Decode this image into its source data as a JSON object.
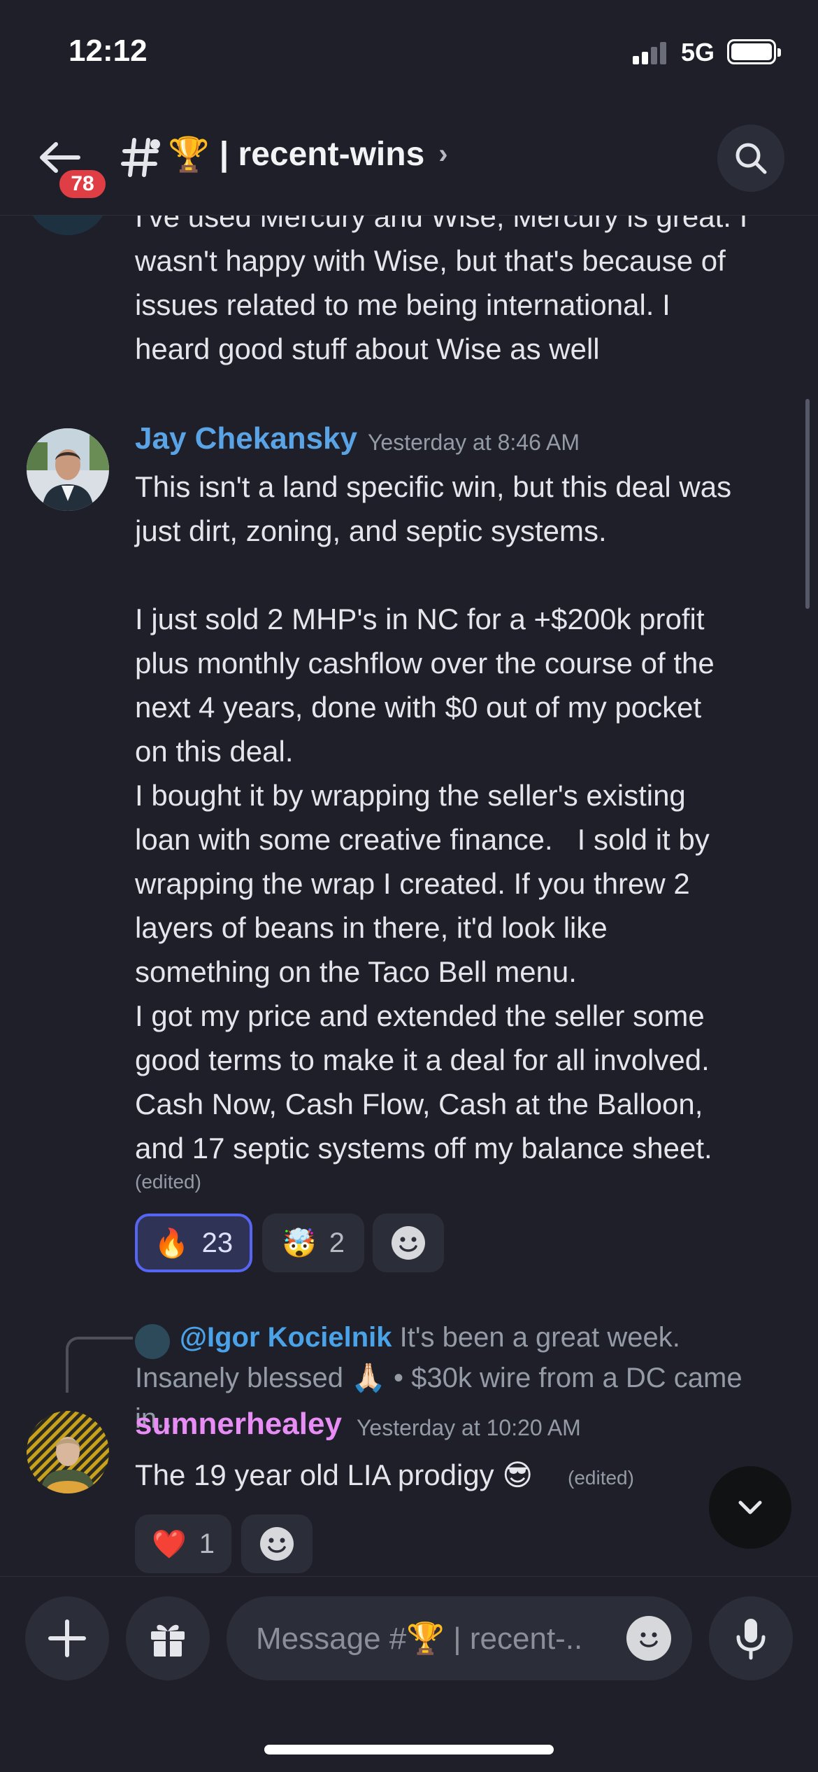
{
  "status_bar": {
    "time": "12:12",
    "network": "5G"
  },
  "header": {
    "mention_count": "78",
    "channel_emoji": "🏆",
    "channel_name": "| recent-wins",
    "chevron": "›"
  },
  "messages": [
    {
      "id": "prev",
      "text": "I've used Mercury and Wise, Mercury is great. I\nwasn't happy with Wise, but that's because of\nissues related to me being international. I\nheard good stuff about Wise as well"
    },
    {
      "id": "jay",
      "author": "Jay Chekansky",
      "author_color": "#5aa4e6",
      "timestamp": "Yesterday at 8:46 AM",
      "text": "This isn't a land specific win, but this deal was\njust dirt, zoning, and septic systems.\n\nI just sold 2 MHP's in NC for a +$200k profit\nplus monthly cashflow over the course of the\nnext 4 years, done with $0 out of my pocket\non this deal.\nI bought it by wrapping the seller's existing\nloan with some creative finance.   I sold it by\nwrapping the wrap I created. If you threw 2\nlayers of beans in there, it'd look like\nsomething on the Taco Bell menu.\nI got my price and extended the seller some\ngood terms to make it a deal for all involved.\nCash Now, Cash Flow, Cash at the Balloon,\nand 17 septic systems off my balance sheet.",
      "edited": "(edited)",
      "reactions": [
        {
          "emoji": "🔥",
          "count": "23",
          "active": true
        },
        {
          "emoji": "🤯",
          "count": "2",
          "active": false
        }
      ]
    },
    {
      "id": "sumner",
      "reply": {
        "mention": "@Igor Kocielnik",
        "text": " It's been a great week. Insanely blessed 🙏🏻 • $30k wire from a DC came in..."
      },
      "author": "sumnerhealey",
      "author_color": "#e78df5",
      "timestamp": "Yesterday at 10:20 AM",
      "text": "The 19 year old LIA prodigy 😎",
      "edited": "(edited)",
      "reactions": [
        {
          "emoji": "❤️",
          "count": "1",
          "active": false
        }
      ]
    }
  ],
  "composer": {
    "placeholder": "Message #🏆 | recent-.."
  },
  "icons": [
    "back-arrow-icon",
    "hash-icon",
    "search-icon",
    "chevron-down-icon",
    "plus-icon",
    "gift-icon",
    "emoji-icon",
    "microphone-icon",
    "add-reaction-icon"
  ]
}
